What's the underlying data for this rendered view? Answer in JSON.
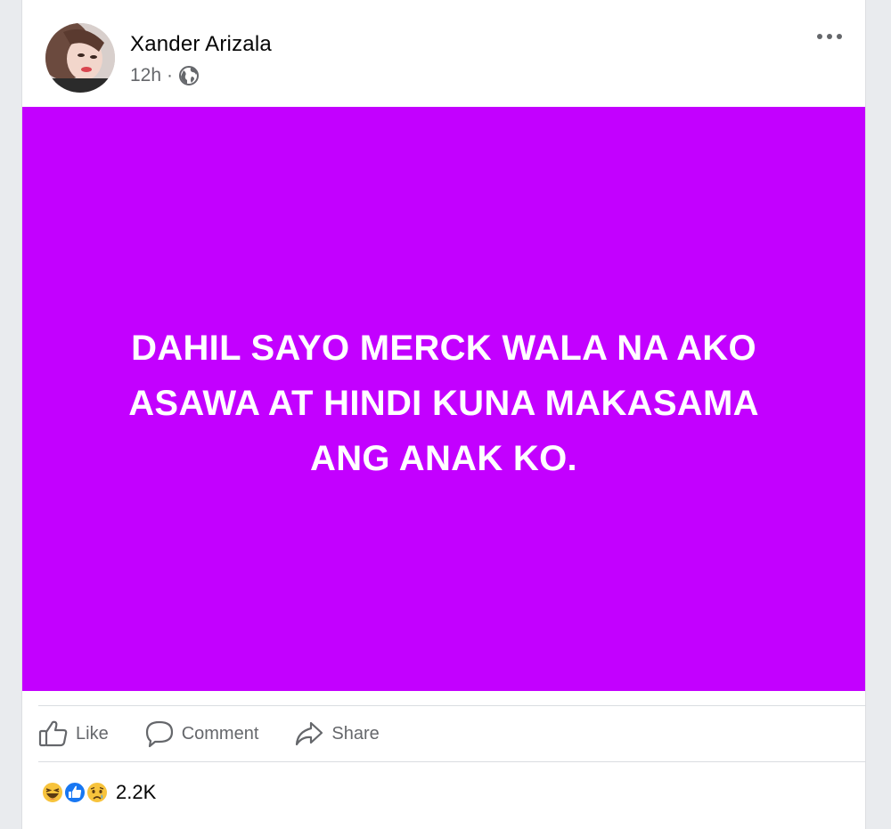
{
  "post": {
    "author": "Xander Arizala",
    "time": "12h",
    "separator": "·",
    "privacy_icon": "globe-icon",
    "menu_icon": "more-options-icon",
    "content_text": "DAHIL SAYO MERCK WALA NA AKO ASAWA AT HINDI KUNA MAKASAMA ANG ANAK KO.",
    "content_background": "#c300ff"
  },
  "actions": {
    "like": "Like",
    "comment": "Comment",
    "share": "Share"
  },
  "reactions": {
    "icons": [
      "haha-reaction-icon",
      "like-reaction-icon",
      "sad-reaction-icon"
    ],
    "count": "2.2K"
  }
}
